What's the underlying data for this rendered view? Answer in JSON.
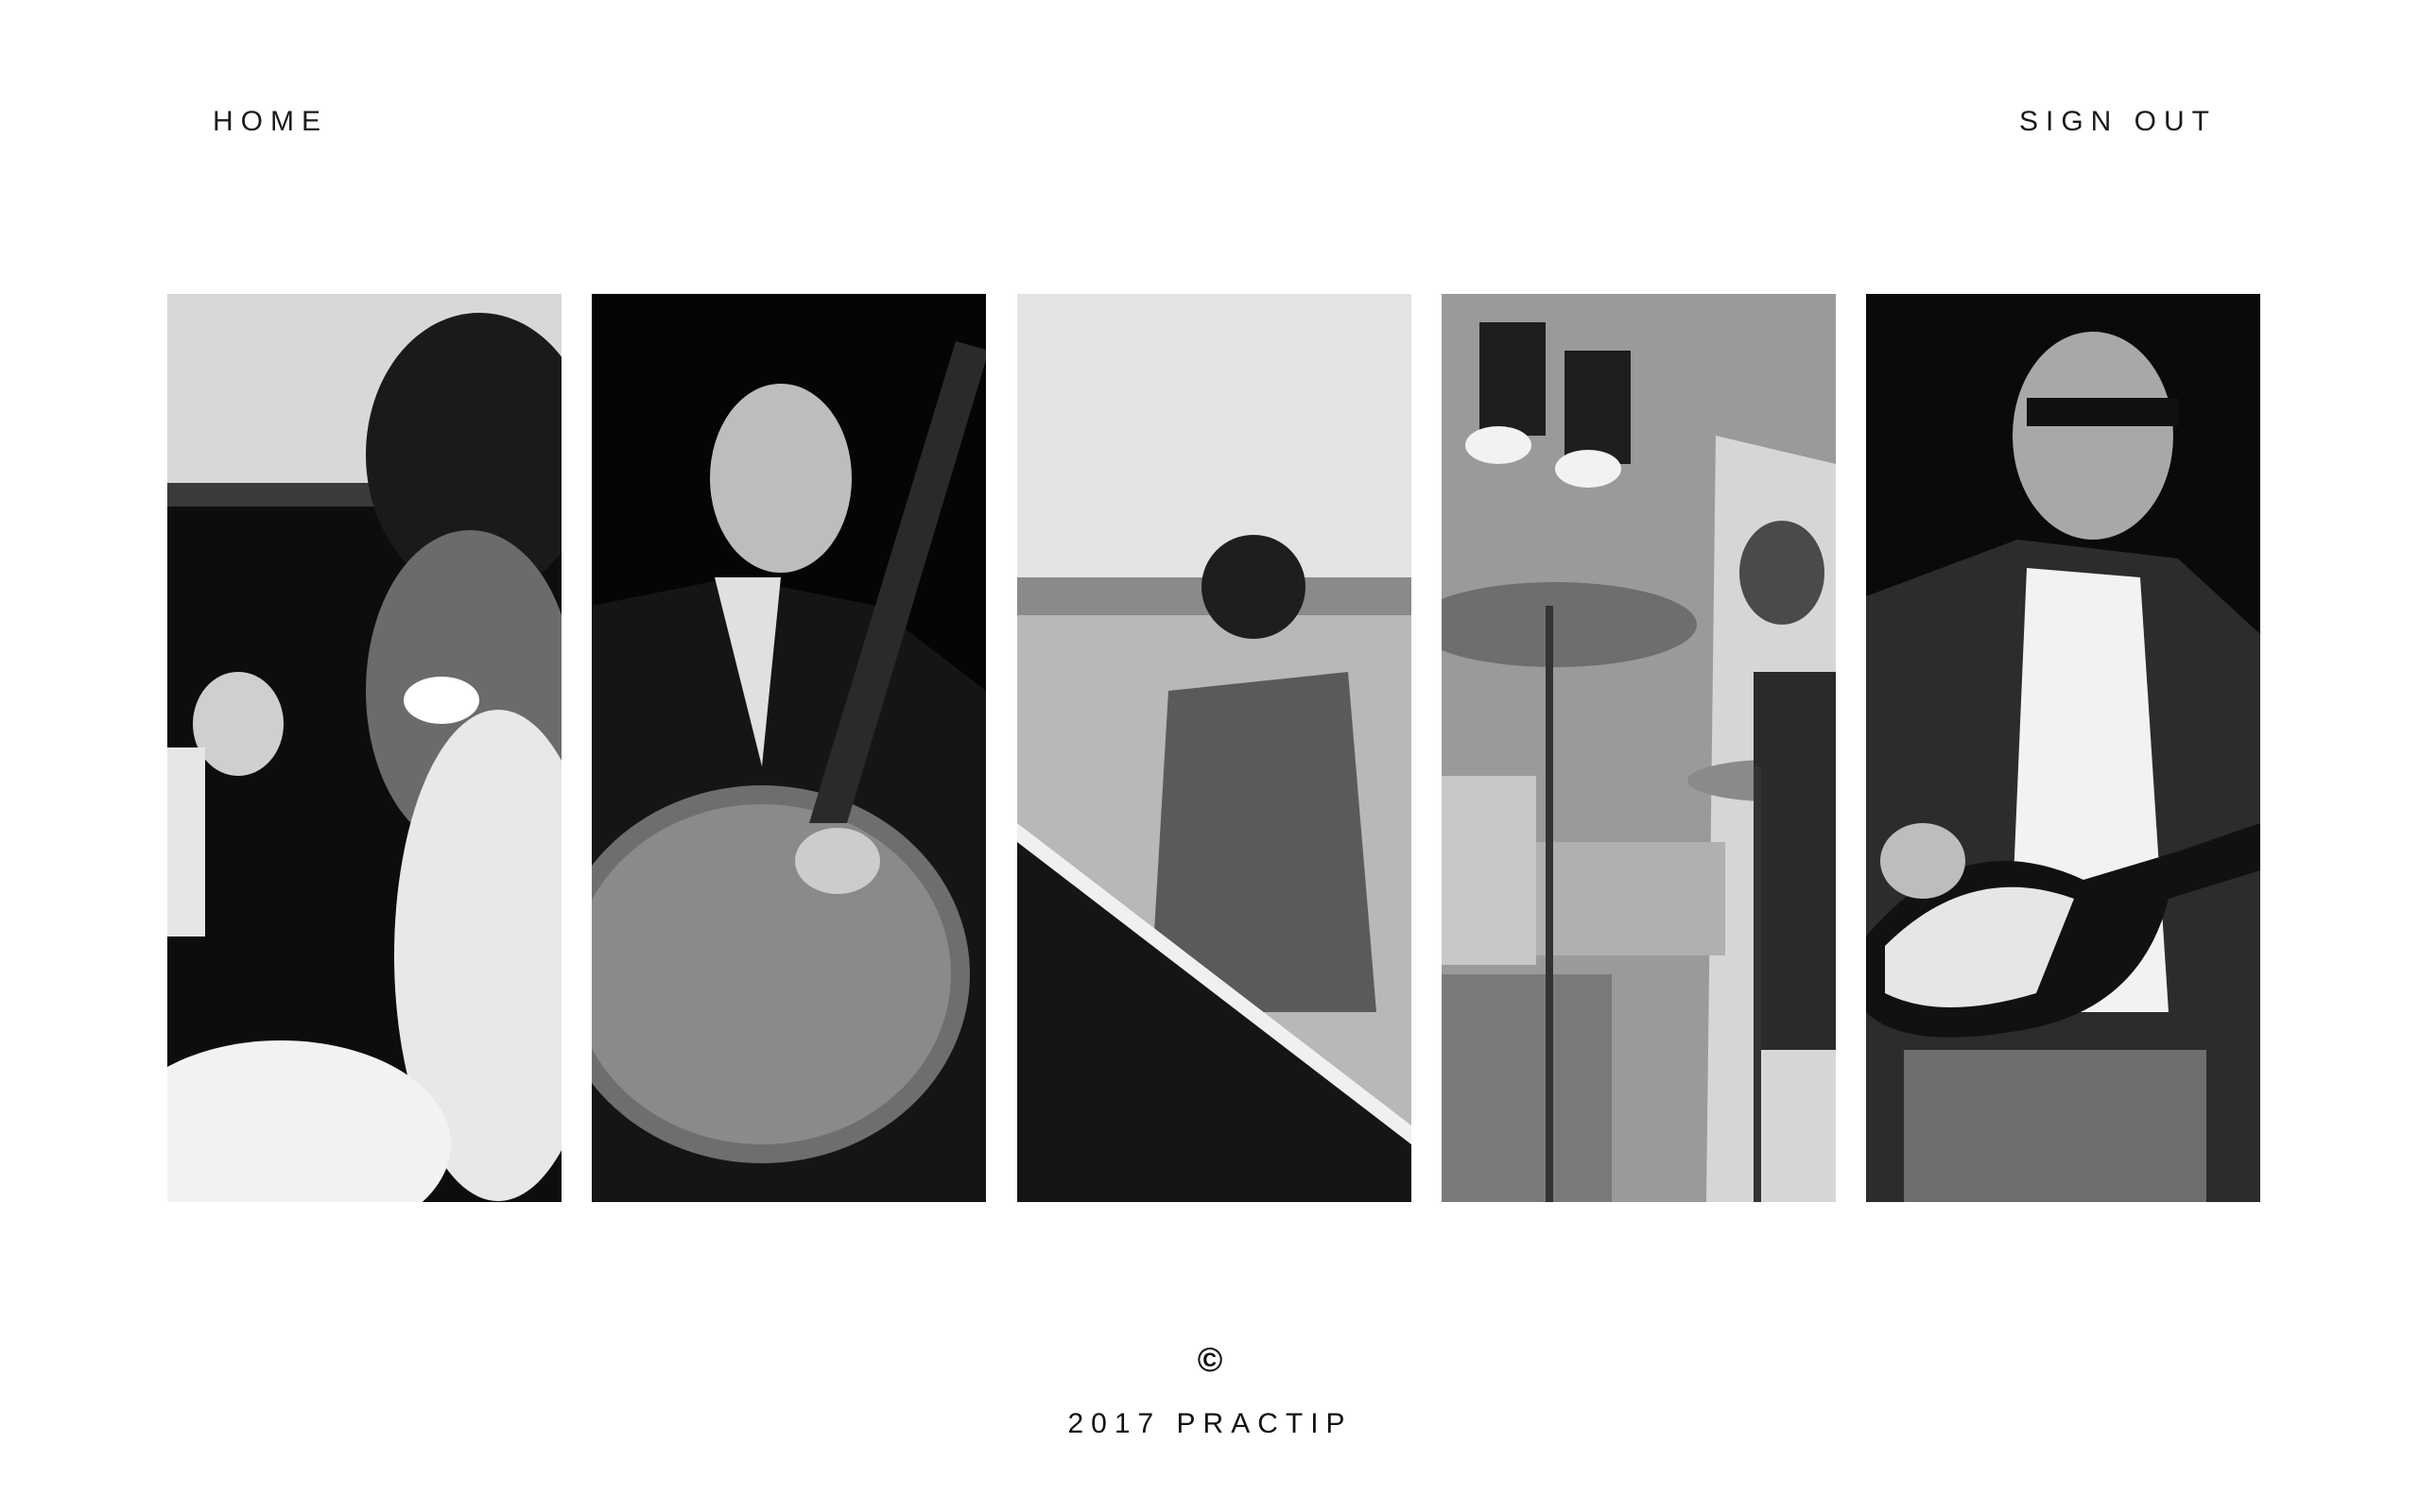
{
  "nav": {
    "home_label": "HOME",
    "signout_label": "SIGN OUT"
  },
  "gallery": {
    "photos": [
      {
        "icon": "singer-photo"
      },
      {
        "icon": "guitarist-photo"
      },
      {
        "icon": "keyboardist-photo"
      },
      {
        "icon": "drummer-photo"
      },
      {
        "icon": "bassist-photo"
      }
    ]
  },
  "footer": {
    "symbol": "©",
    "text": "2017 PRACTIP"
  },
  "colors": {
    "background": "#ffffff",
    "text": "#1a1a1a"
  }
}
